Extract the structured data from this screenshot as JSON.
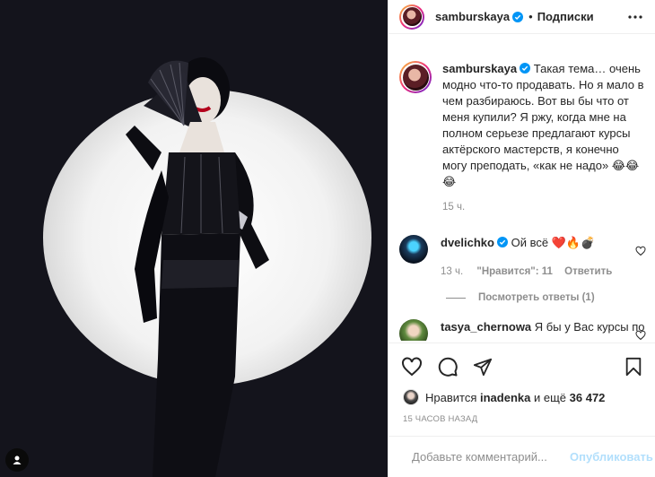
{
  "post": {
    "author": "samburskaya",
    "follow_label": "Подписки",
    "separator": "•"
  },
  "caption": {
    "author": "samburskaya",
    "text": "Такая тема… очень модно что-то продавать. Но я мало в чем разбираюсь. Вот вы бы что от меня купили? Я ржу, когда мне на полном серьезе предлагают курсы актёрского мастерств, я конечно могу преподать, «как не надо» 😂😂😂",
    "time": "15 ч."
  },
  "comments": [
    {
      "author": "dvelichko",
      "text": "Ой всё ❤️🔥💣",
      "time": "13 ч.",
      "likes_label": "\"Нравится\": 11",
      "reply_label": "Ответить",
      "view_replies": "Посмотреть ответы (1)"
    },
    {
      "author": "tasya_chernowa",
      "text": "Я бы у Вас курсы по ответам на тупые"
    }
  ],
  "likes": {
    "prefix": "Нравится",
    "user": "inadenka",
    "middle": "и ещё",
    "count": "36 472"
  },
  "time_ago": "15 ЧАСОВ НАЗАД",
  "add_comment": {
    "placeholder": "Добавьте комментарий...",
    "publish_label": "Опубликовать"
  },
  "colors": {
    "accent": "#0095f6",
    "publish_disabled": "#b2dffc",
    "heart_red": "#ed4956",
    "muted": "#8e8e8e"
  },
  "icons": [
    "verified-icon",
    "more-icon",
    "heart-icon",
    "comment-icon",
    "share-icon",
    "bookmark-icon",
    "emoji-icon"
  ]
}
